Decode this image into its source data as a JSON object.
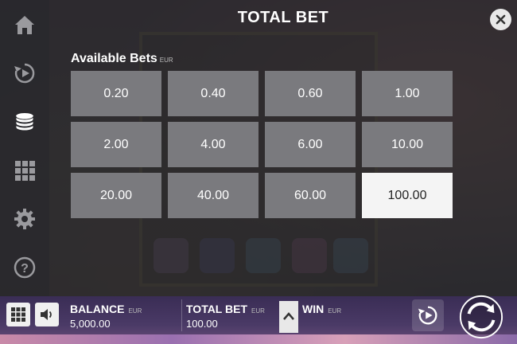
{
  "modal": {
    "title": "TOTAL BET",
    "section_label": "Available Bets",
    "currency": "EUR",
    "bets": [
      "0.20",
      "0.40",
      "0.60",
      "1.00",
      "2.00",
      "4.00",
      "6.00",
      "10.00",
      "20.00",
      "40.00",
      "60.00",
      "100.00"
    ],
    "selected_bet": "100.00"
  },
  "sidebar": {
    "items": [
      {
        "icon": "home-icon"
      },
      {
        "icon": "replay-icon"
      },
      {
        "icon": "coin-stack-icon",
        "active": true
      },
      {
        "icon": "paytable-grid-icon"
      },
      {
        "icon": "settings-gear-icon"
      },
      {
        "icon": "help-icon"
      }
    ]
  },
  "bottom_bar": {
    "balance_label": "BALANCE",
    "balance_currency": "EUR",
    "balance_value": "5,000.00",
    "total_bet_label": "TOTAL BET",
    "total_bet_currency": "EUR",
    "total_bet_value": "100.00",
    "win_label": "WIN",
    "win_currency": "EUR",
    "win_value": ""
  },
  "colors": {
    "bet_tile": "#7a7a7e",
    "bet_selected": "#f4f4f4",
    "sidebar_icon": "#9a9a9e",
    "sidebar_icon_active": "#ffffff"
  }
}
